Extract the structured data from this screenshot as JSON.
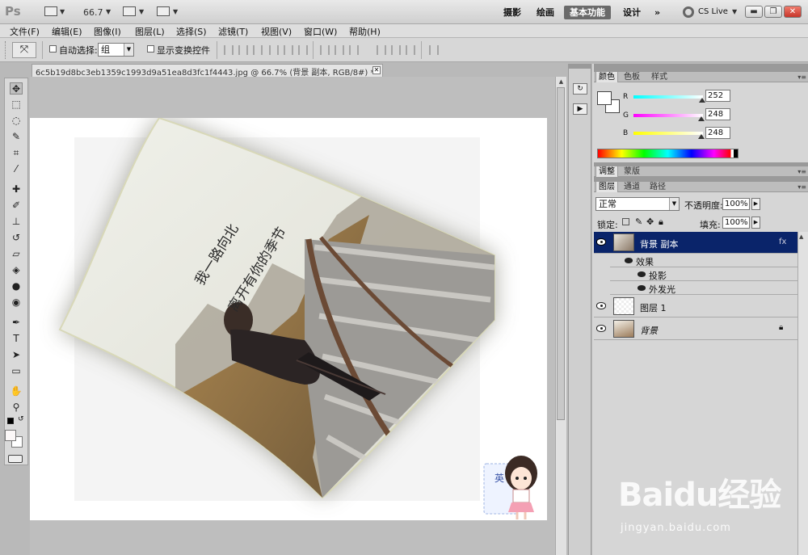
{
  "app": {
    "logo": "Ps",
    "zoom": "66.7",
    "workspaces": [
      "摄影",
      "绘画",
      "基本功能",
      "设计",
      "»"
    ],
    "active_workspace": "基本功能",
    "cs_live": "CS Live"
  },
  "menu": [
    "文件(F)",
    "编辑(E)",
    "图像(I)",
    "图层(L)",
    "选择(S)",
    "滤镜(T)",
    "视图(V)",
    "窗口(W)",
    "帮助(H)"
  ],
  "options": {
    "auto_select_label": "自动选择:",
    "auto_select_value": "组",
    "show_transform_label": "显示变换控件"
  },
  "document": {
    "tab_title": "6c5b19d8bc3eb1359c1993d9a51ea8d3fc1f4443.jpg @ 66.7% (背景 副本, RGB/8#) *",
    "poster_text_line1": "我一路向北",
    "poster_text_line2": "离开有你的季节",
    "sticker_text": "英"
  },
  "color_panel": {
    "tabs": [
      "颜色",
      "色板",
      "样式"
    ],
    "r_label": "R",
    "g_label": "G",
    "b_label": "B",
    "r": "252",
    "g": "248",
    "b": "248",
    "r_value": 252,
    "g_value": 248,
    "b_value": 248
  },
  "adjust_tabs": [
    "调整",
    "蒙版"
  ],
  "layers_panel": {
    "tabs": [
      "图层",
      "通道",
      "路径"
    ],
    "blend_mode": "正常",
    "opacity_label": "不透明度:",
    "opacity": "100%",
    "lock_label": "锁定:",
    "fill_label": "填充:",
    "fill": "100%",
    "layers": [
      {
        "name": "背景 副本",
        "selected": true
      },
      {
        "name": "图层 1",
        "selected": false
      },
      {
        "name": "背景",
        "selected": false
      }
    ],
    "effects_label": "效果",
    "effects": [
      "投影",
      "外发光"
    ]
  },
  "watermark": {
    "text": "Baidu经验",
    "url": "jingyan.baidu.com"
  }
}
